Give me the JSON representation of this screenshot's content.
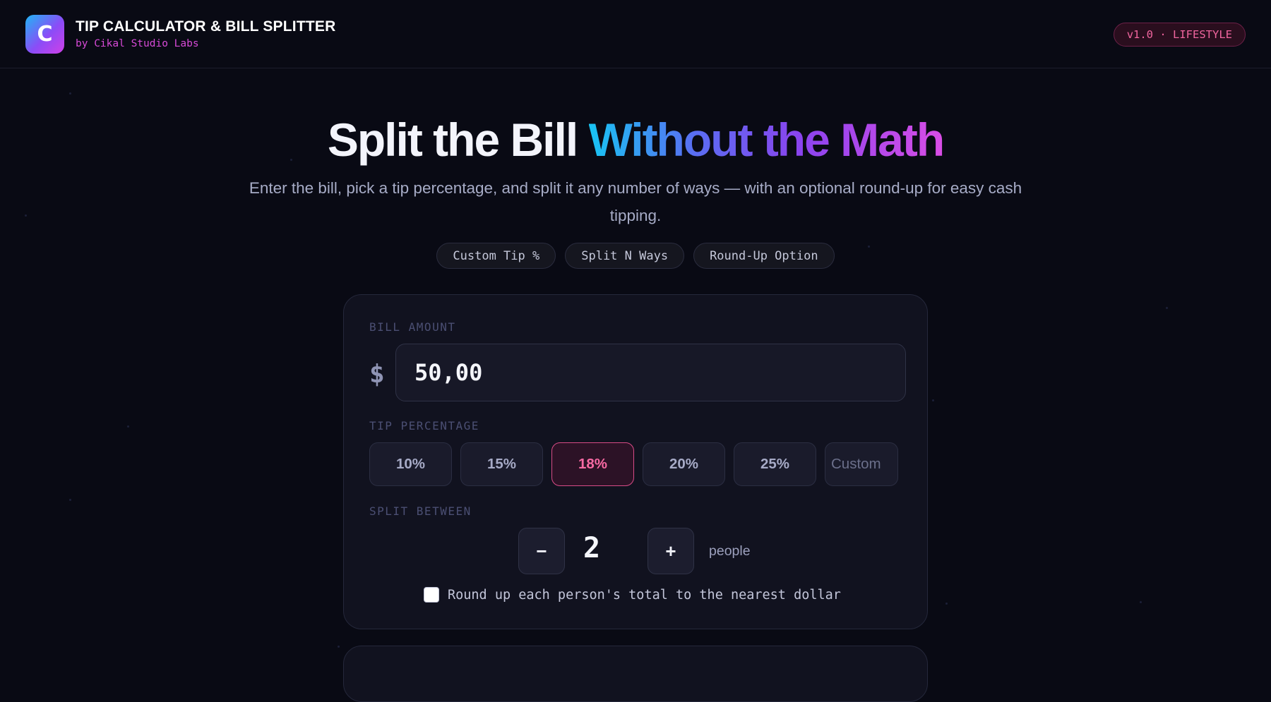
{
  "app": {
    "logo_letter": "C",
    "title": "TIP CALCULATOR & BILL SPLITTER",
    "subtitle": "by Cikal Studio Labs",
    "version_badge": "v1.0 · LIFESTYLE"
  },
  "hero": {
    "title_plain": "Split the Bill ",
    "title_gradient": "Without the Math",
    "description": "Enter the bill, pick a tip percentage, and split it any number of ways — with an optional round-up for easy cash tipping.",
    "chips": [
      "Custom Tip %",
      "Split N Ways",
      "Round-Up Option"
    ]
  },
  "form": {
    "bill_label": "BILL AMOUNT",
    "currency_symbol": "$",
    "bill_value": "50,00",
    "tip_label": "TIP PERCENTAGE",
    "tip_options": [
      "10%",
      "15%",
      "18%",
      "20%",
      "25%"
    ],
    "tip_selected": "18%",
    "tip_custom_placeholder": "Custom",
    "split_label": "SPLIT BETWEEN",
    "decrement_symbol": "−",
    "increment_symbol": "+",
    "people_count": "2",
    "people_unit": "people",
    "roundup_checked": false,
    "roundup_label": "Round up each person's total to the nearest dollar"
  },
  "colors": {
    "background": "#090a14",
    "accent_pink": "#f96aa4",
    "accent_magenta": "#d74ad7",
    "accent_cyan": "#18c4f3"
  }
}
